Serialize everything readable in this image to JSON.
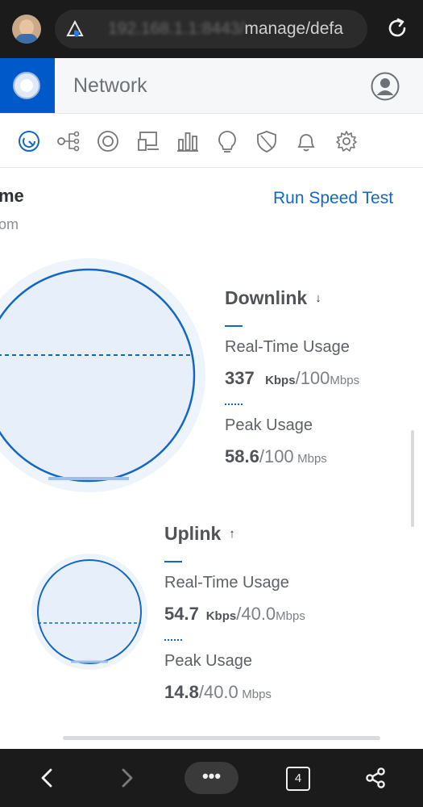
{
  "browser": {
    "url_hidden": "192.168.1.1:8443/",
    "url_visible": "manage/defa",
    "colors": {
      "bar": "#1b1b1b",
      "pill": "#2b2b2b"
    }
  },
  "app": {
    "title": "Network",
    "brand_color": "#0059c8"
  },
  "nav_icons": [
    "dashboard-icon",
    "topology-icon",
    "devices-icon",
    "clients-icon",
    "statistics-icon",
    "insights-icon",
    "security-icon",
    "alerts-icon",
    "settings-icon"
  ],
  "section": {
    "title_partial": "me",
    "subtitle_partial": "om",
    "speed_test_label": "Run Speed Test"
  },
  "downlink": {
    "title": "Downlink",
    "arrow": "↓",
    "realtime_label": "Real-Time Usage",
    "realtime_value": "337",
    "realtime_unit": "Kbps",
    "realtime_max": "100",
    "realtime_max_unit": "Mbps",
    "peak_label": "Peak Usage",
    "peak_value": "58.6",
    "peak_max": "100",
    "peak_max_unit": "Mbps",
    "peak_fraction": 0.586,
    "realtime_fraction": 0.0034
  },
  "uplink": {
    "title": "Uplink",
    "arrow": "↑",
    "realtime_label": "Real-Time Usage",
    "realtime_value": "54.7",
    "realtime_unit": "Kbps",
    "realtime_max": "40.0",
    "realtime_max_unit": "Mbps",
    "peak_label": "Peak Usage",
    "peak_value": "14.8",
    "peak_max": "40.0",
    "peak_max_unit": "Mbps",
    "peak_fraction": 0.37,
    "realtime_fraction": 0.0014
  },
  "bottom_bar": {
    "more_label": "•••",
    "tab_count": "4"
  },
  "colors": {
    "accent": "#1567c4",
    "gauge_fill": "#e6effa",
    "gauge_halo": "#eef4fc"
  }
}
